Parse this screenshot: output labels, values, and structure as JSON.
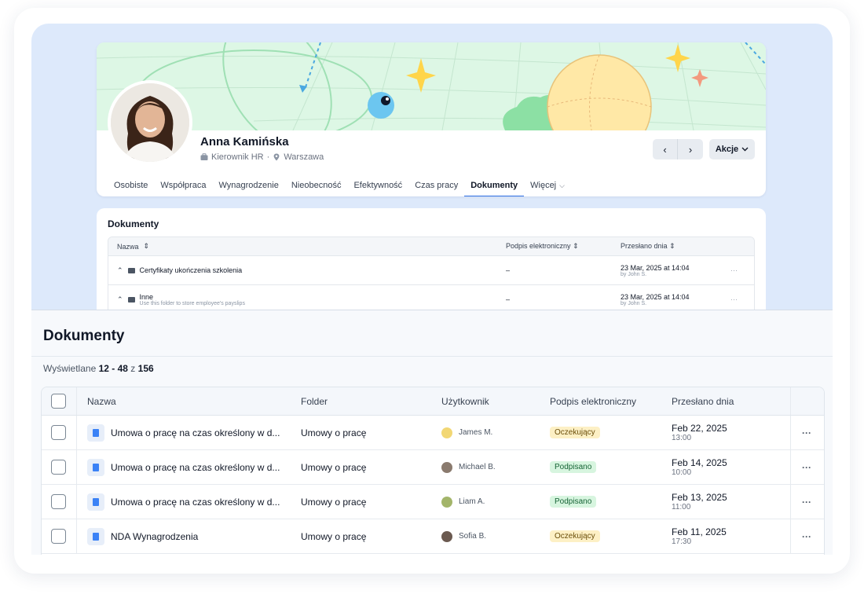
{
  "profile": {
    "name": "Anna Kamińska",
    "role": "Kierownik HR",
    "location": "Warszawa",
    "actions_label": "Akcje",
    "tabs": [
      {
        "label": "Osobiste"
      },
      {
        "label": "Współpraca"
      },
      {
        "label": "Wynagrodzenie"
      },
      {
        "label": "Nieobecność"
      },
      {
        "label": "Efektywność"
      },
      {
        "label": "Czas pracy"
      },
      {
        "label": "Dokumenty"
      },
      {
        "label": "Więcej"
      }
    ]
  },
  "docs_card": {
    "title": "Dokumenty",
    "columns": {
      "name": "Nazwa",
      "esign": "Podpis elektroniczny",
      "sent": "Przesłano dnia"
    },
    "rows": [
      {
        "name": "Certyfikaty ukończenia szkolenia",
        "subtitle": "",
        "esign": "–",
        "date": "23 Mar, 2025 at 14:04",
        "by": "by John S."
      },
      {
        "name": "Inne",
        "subtitle": "Use this folder to store employee's payslips",
        "esign": "–",
        "date": "23 Mar, 2025 at 14:04",
        "by": "by John S."
      }
    ]
  },
  "documents": {
    "title": "Dokumenty",
    "count_prefix": "Wyświetlane",
    "count_range": "12 - 48",
    "count_of": "z",
    "count_total": "156",
    "columns": {
      "name": "Nazwa",
      "folder": "Folder",
      "user": "Użytkownik",
      "esign": "Podpis elektroniczny",
      "sent": "Przesłano dnia"
    },
    "rows": [
      {
        "name": "Umowa o pracę na czas określony w d...",
        "folder": "Umowy o pracę",
        "user": "James M.",
        "avatar_color": "#f2d774",
        "status": "Oczekujący",
        "status_type": "pending",
        "date": "Feb 22, 2025",
        "time": "13:00"
      },
      {
        "name": "Umowa o pracę na czas określony w d...",
        "folder": "Umowy o pracę",
        "user": "Michael B.",
        "avatar_color": "#8a7a6e",
        "status": "Podpisano",
        "status_type": "signed",
        "date": "Feb 14, 2025",
        "time": "10:00"
      },
      {
        "name": "Umowa o pracę na czas określony w d...",
        "folder": "Umowy o pracę",
        "user": "Liam A.",
        "avatar_color": "#a3b56a",
        "status": "Podpisano",
        "status_type": "signed",
        "date": "Feb 13, 2025",
        "time": "11:00"
      },
      {
        "name": "NDA Wynagrodzenia",
        "folder": "Umowy o pracę",
        "user": "Sofia B.",
        "avatar_color": "#6b5a50",
        "status": "Oczekujący",
        "status_type": "pending",
        "date": "Feb 11, 2025",
        "time": "17:30"
      }
    ]
  },
  "colors": {
    "accent": "#2f6fe4",
    "page_bg": "#dde9fb",
    "pending_bg": "#fdf0c5",
    "signed_bg": "#d7f5df"
  }
}
